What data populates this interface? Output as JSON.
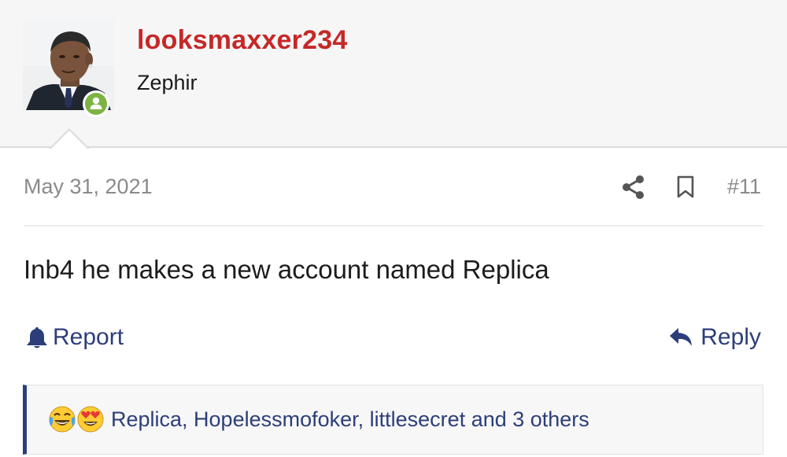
{
  "user": {
    "username": "looksmaxxer234",
    "title": "Zephir",
    "online": true
  },
  "post": {
    "date": "May 31, 2021",
    "number": "#11",
    "body": "Inb4 he makes a new account named Replica"
  },
  "actions": {
    "report_label": "Report",
    "reply_label": "Reply"
  },
  "reactions": {
    "emojis": [
      "face-with-tears-of-joy-icon",
      "heart-eyes-icon"
    ],
    "text": "Replica, Hopelessmofoker, littlesecret and 3 others"
  },
  "colors": {
    "username": "#c62828",
    "link": "#2c3e7a",
    "online": "#7cb342",
    "muted": "#8a8a8a"
  }
}
